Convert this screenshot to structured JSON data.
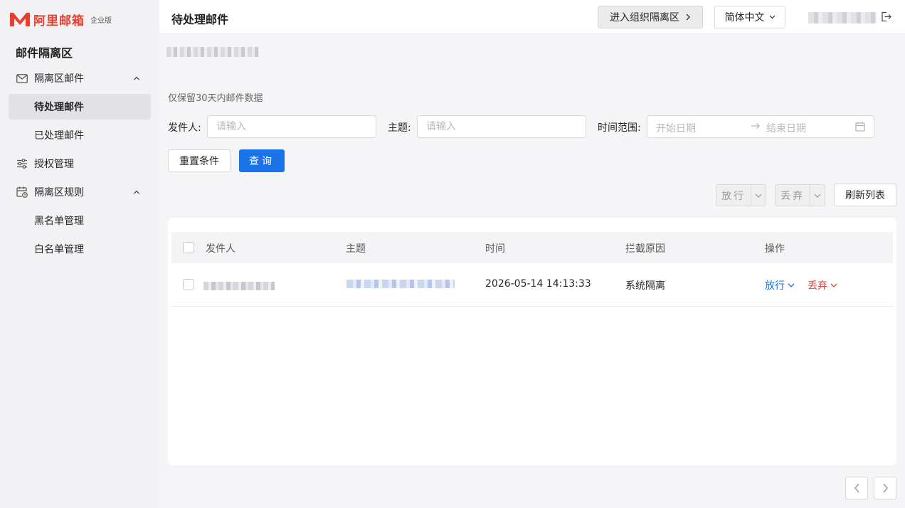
{
  "app": {
    "logo_text": "阿里邮箱",
    "logo_sub": "企业版",
    "brand_color": "#e8402f"
  },
  "sidebar": {
    "title": "邮件隔离区",
    "items": [
      {
        "label": "隔离区邮件",
        "icon": "mail-icon",
        "expanded": true
      },
      {
        "label": "待处理邮件",
        "active": true
      },
      {
        "label": "已处理邮件"
      },
      {
        "label": "授权管理",
        "icon": "sliders-icon"
      },
      {
        "label": "隔离区规则",
        "icon": "calendar-clock-icon",
        "expanded": true
      },
      {
        "label": "黑名单管理"
      },
      {
        "label": "白名单管理"
      }
    ]
  },
  "header": {
    "title": "待处理邮件",
    "org_button": "进入组织隔离区",
    "language": "简体中文"
  },
  "main": {
    "hint": "仅保留30天内邮件数据",
    "filters": {
      "sender_label": "发件人:",
      "sender_placeholder": "请输入",
      "subject_label": "主题:",
      "subject_placeholder": "请输入",
      "time_label": "时间范围:",
      "start_placeholder": "开始日期",
      "end_placeholder": "结束日期"
    },
    "reset_button": "重置条件",
    "search_button": "查询",
    "release_button": "放行",
    "discard_button": "丢弃",
    "refresh_button": "刷新列表",
    "accent_color": "#1a73e8",
    "danger_color": "#e0443e"
  },
  "table": {
    "columns": [
      "发件人",
      "主题",
      "时间",
      "拦截原因",
      "操作"
    ],
    "rows": [
      {
        "time": "2026-05-14 14:13:33",
        "reason": "系统隔离",
        "release": "放行",
        "discard": "丢弃"
      }
    ]
  }
}
